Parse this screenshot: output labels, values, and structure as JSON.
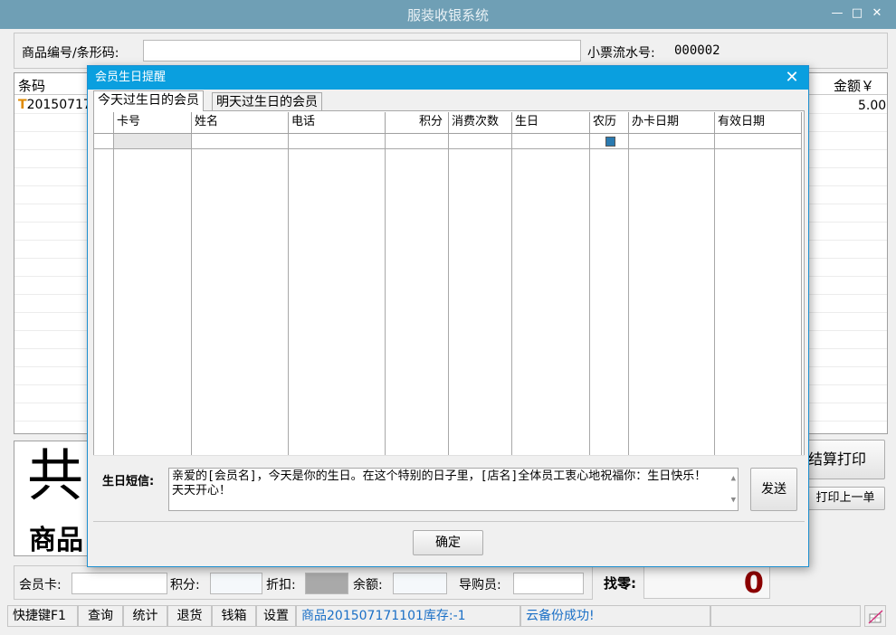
{
  "window": {
    "title": "服装收银系统",
    "minimize_glyph": "—",
    "maximize_glyph": "□",
    "close_glyph": "✕"
  },
  "top": {
    "barcode_label": "商品编号/条形码:",
    "barcode_value": "",
    "receipt_label": "小票流水号:",
    "receipt_no": "000002"
  },
  "grid": {
    "col_barcode": "条码",
    "col_amount": "金额￥",
    "rows": [
      {
        "marker": "T",
        "barcode": "20150717",
        "amount": "5.00"
      }
    ]
  },
  "summary": {
    "total_big_char": "共",
    "goods_label": "商品"
  },
  "right_buttons": {
    "checkout_print": "结算打印",
    "print_last": "打印上一单"
  },
  "member_bar": {
    "card_label": "会员卡:",
    "points_label": "积分:",
    "discount_label": "折扣:",
    "balance_label": "余额:",
    "guide_label": "导购员:",
    "change_label": "找零:",
    "change_value": "0"
  },
  "statusbar": {
    "shortcut": "快捷键F1",
    "query": "查询",
    "stats": "统计",
    "return": "退货",
    "cashbox": "钱箱",
    "settings": "设置",
    "stock_msg": "商品201507171101库存:-1",
    "cloud_msg": "云备份成功!"
  },
  "modal": {
    "title": "会员生日提醒",
    "close_glyph": "✕",
    "tabs": [
      {
        "label": "今天过生日的会员",
        "active": true
      },
      {
        "label": "明天过生日的会员",
        "active": false
      }
    ],
    "columns": [
      "卡号",
      "姓名",
      "电话",
      "积分",
      "消费次数",
      "生日",
      "农历",
      "办卡日期",
      "有效日期"
    ],
    "sms_label": "生日短信:",
    "sms_text": "亲爱的[会员名]，今天是你的生日。在这个特别的日子里，[店名]全体员工衷心地祝福你：生日快乐！天天开心！",
    "send_button": "发送",
    "ok_button": "确定"
  },
  "colors": {
    "title_bar": "#6f9fb5",
    "modal_title": "#0a9fdf",
    "change_value": "#8b0000",
    "status_blue_text": "#1a6fc6",
    "marker_orange": "#e08a00"
  }
}
